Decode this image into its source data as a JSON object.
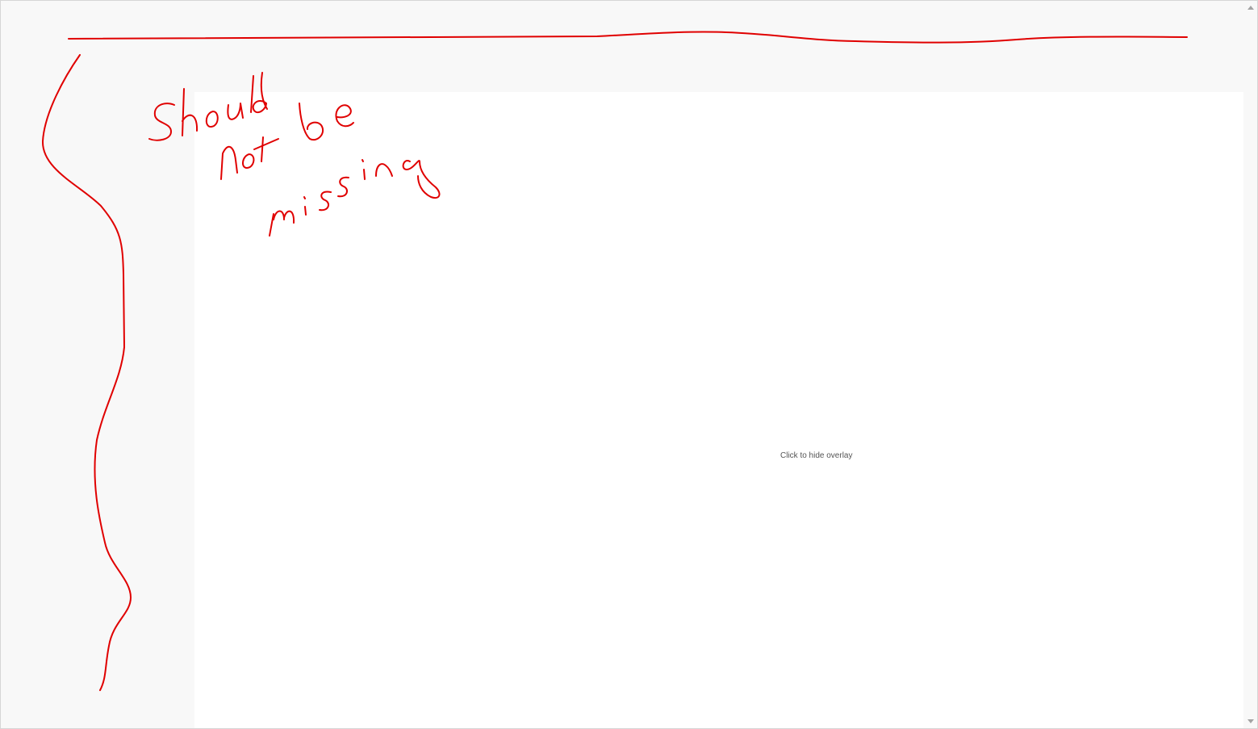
{
  "content": {
    "overlay_hint": "Click to hide overlay"
  },
  "annotation": {
    "handwritten_note": "Should not be missing",
    "ink_color": "#e00000"
  },
  "colors": {
    "chrome_background": "#f8f8f8",
    "content_background": "#ffffff",
    "hint_text": "#555555"
  }
}
